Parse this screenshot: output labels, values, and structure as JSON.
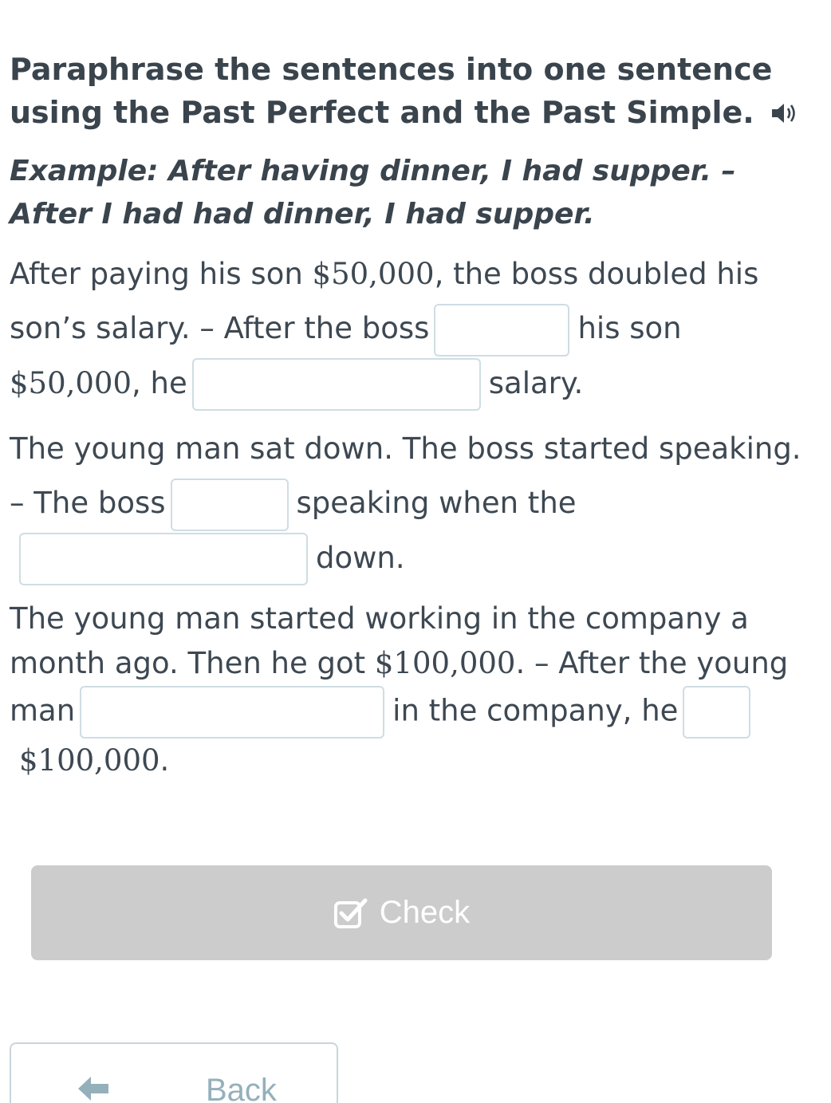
{
  "instruction": {
    "title": "Paraphrase the sentences into one sentence using the Past Perfect and the Past Simple.",
    "example": "Example: After having dinner, I had supper. – After I had had dinner, I had supper."
  },
  "tasks": [
    {
      "seg1": "After paying his son ",
      "num1": "$50,000",
      "seg2": ", the boss doubled his son’s salary. – After the boss",
      "seg3": "his son",
      "num2": "$50,000",
      "seg4": ", he",
      "seg5": "salary."
    },
    {
      "seg1": "The young man sat down. The boss started speaking. – The boss",
      "seg2": "speaking when the",
      "seg3": "down."
    },
    {
      "seg1": "The young man started working in the company a month ago. Then he got ",
      "num1": "$100,000",
      "seg2": ". – After the young man",
      "seg3": "in the company, he",
      "num2": "$100,000",
      "seg4": "."
    }
  ],
  "buttons": {
    "check": "Check",
    "back": "Back"
  },
  "colors": {
    "check_bg": "#cccccc",
    "input_border": "#cfdde3",
    "back_text": "#94b0bb"
  }
}
